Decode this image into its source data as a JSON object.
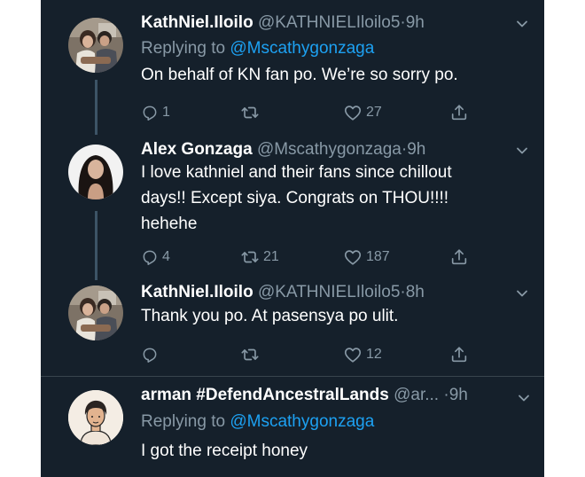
{
  "tweets": [
    {
      "name": "KathNiel.Iloilo",
      "handle": "@KATHNIELIloilo5",
      "time": "9h",
      "replying_label": "Replying to",
      "replying_to": "@Mscathygonzaga",
      "lines": [
        "On behalf of KN fan po. We’re so sorry po."
      ],
      "replies": "1",
      "retweets": "",
      "likes": "27"
    },
    {
      "name": "Alex Gonzaga",
      "handle": "@Mscathygonzaga",
      "time": "9h",
      "lines": [
        "I love kathniel and their fans since chillout",
        "days!! Except siya. Congrats on THOU!!!!",
        "hehehe"
      ],
      "replies": "4",
      "retweets": "21",
      "likes": "187"
    },
    {
      "name": "KathNiel.Iloilo",
      "handle": "@KATHNIELIloilo5",
      "time": "8h",
      "lines": [
        "Thank you po. At pasensya po ulit."
      ],
      "replies": "",
      "retweets": "",
      "likes": "12"
    },
    {
      "name": "arman #DefendAncestralLands",
      "handle": "@ar...",
      "time": "9h",
      "replying_label": "Replying to",
      "replying_to": "@Mscathygonzaga",
      "lines": [
        "I got the receipt honey"
      ]
    }
  ],
  "separator": "·",
  "icons": {
    "reply": "reply-icon",
    "retweet": "retweet-icon",
    "like": "heart-icon",
    "share": "share-icon",
    "more": "chevron-down-icon"
  },
  "colors": {
    "background": "#15202b",
    "text": "#ffffff",
    "muted": "#8899a6",
    "link": "#1da1f2",
    "thread_line": "#3d5466"
  }
}
